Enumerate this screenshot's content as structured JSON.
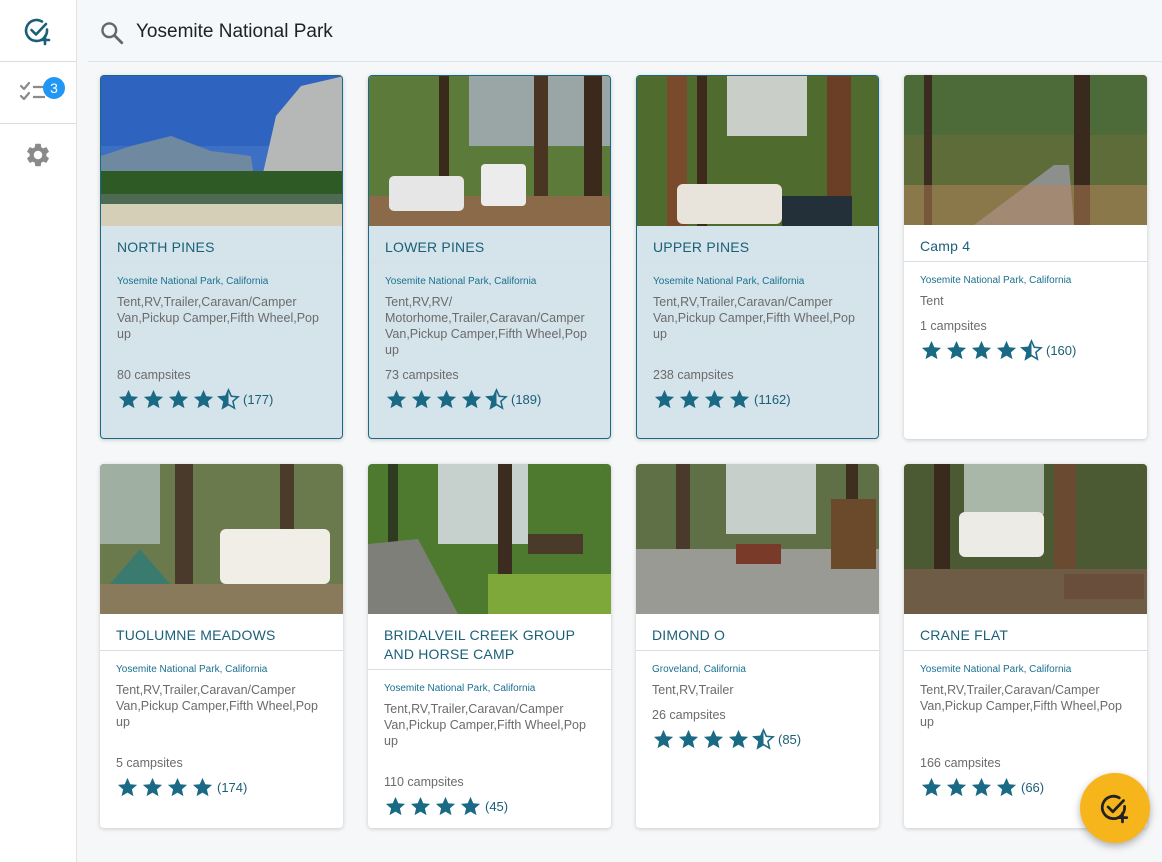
{
  "search": {
    "value": "Yosemite National Park"
  },
  "sidebar": {
    "badge_count": "3"
  },
  "colors": {
    "accent": "#1a5f78",
    "star": "#1a6a86",
    "fab": "#f7b51c",
    "badge": "#2196f3"
  },
  "campgrounds": [
    {
      "name": "NORTH PINES",
      "location": "Yosemite National Park, California",
      "types": "Tent,RV,Trailer,Caravan/Camper Van,Pickup Camper,Fifth Wheel,Pop up",
      "sites": "80 campsites",
      "rating": 4.5,
      "reviews": "(177)",
      "selected": true
    },
    {
      "name": "LOWER PINES",
      "location": "Yosemite National Park, California",
      "types": "Tent,RV,RV/ Motorhome,Trailer,Caravan/Camper Van,Pickup Camper,Fifth Wheel,Pop up",
      "sites": "73 campsites",
      "rating": 4.5,
      "reviews": "(189)",
      "selected": true
    },
    {
      "name": "UPPER PINES",
      "location": "Yosemite National Park, California",
      "types": "Tent,RV,Trailer,Caravan/Camper Van,Pickup Camper,Fifth Wheel,Pop up",
      "sites": "238 campsites",
      "rating": 4,
      "reviews": "(1162)",
      "selected": true
    },
    {
      "name": "Camp 4",
      "location": "Yosemite National Park, California",
      "types": "Tent",
      "sites": "1 campsites",
      "rating": 4.5,
      "reviews": "(160)",
      "selected": false
    },
    {
      "name": "TUOLUMNE MEADOWS",
      "location": "Yosemite National Park, California",
      "types": "Tent,RV,Trailer,Caravan/Camper Van,Pickup Camper,Fifth Wheel,Pop up",
      "sites": "5 campsites",
      "rating": 4,
      "reviews": "(174)",
      "selected": false
    },
    {
      "name": "BRIDALVEIL CREEK GROUP AND HORSE CAMP",
      "location": "Yosemite National Park, California",
      "types": "Tent,RV,Trailer,Caravan/Camper Van,Pickup Camper,Fifth Wheel,Pop up",
      "sites": "110 campsites",
      "rating": 4,
      "reviews": "(45)",
      "selected": false
    },
    {
      "name": "DIMOND O",
      "location": "Groveland, California",
      "types": "Tent,RV,Trailer",
      "sites": "26 campsites",
      "rating": 4.5,
      "reviews": "(85)",
      "selected": false
    },
    {
      "name": "CRANE FLAT",
      "location": "Yosemite National Park, California",
      "types": "Tent,RV,Trailer,Caravan/Camper Van,Pickup Camper,Fifth Wheel,Pop up",
      "sites": "166 campsites",
      "rating": 4,
      "reviews": "(66)",
      "selected": false
    }
  ]
}
